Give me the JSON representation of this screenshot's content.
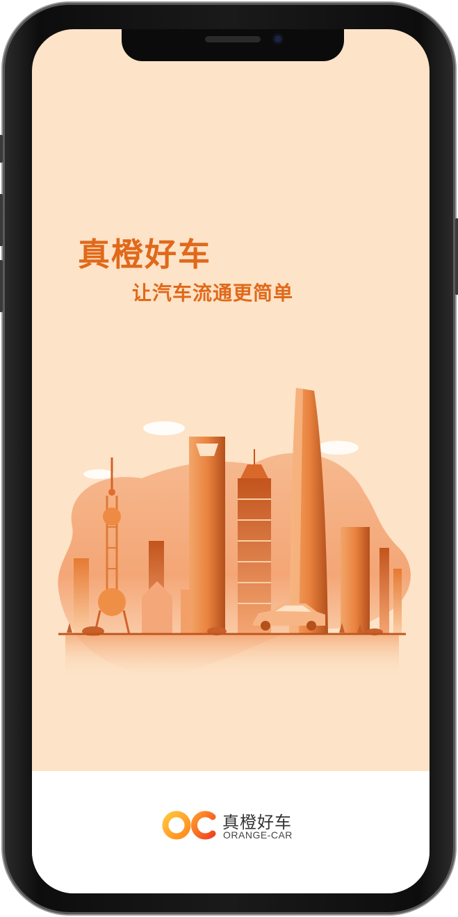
{
  "splash": {
    "title": "真橙好车",
    "slogan": "让汽车流通更简单"
  },
  "brand": {
    "name_cn": "真橙好车",
    "name_en": "ORANGE-CAR",
    "logo_icon": "oc-logo-icon"
  },
  "colors": {
    "background": "#fde3c7",
    "accent": "#e0691b",
    "footer": "#ffffff"
  }
}
